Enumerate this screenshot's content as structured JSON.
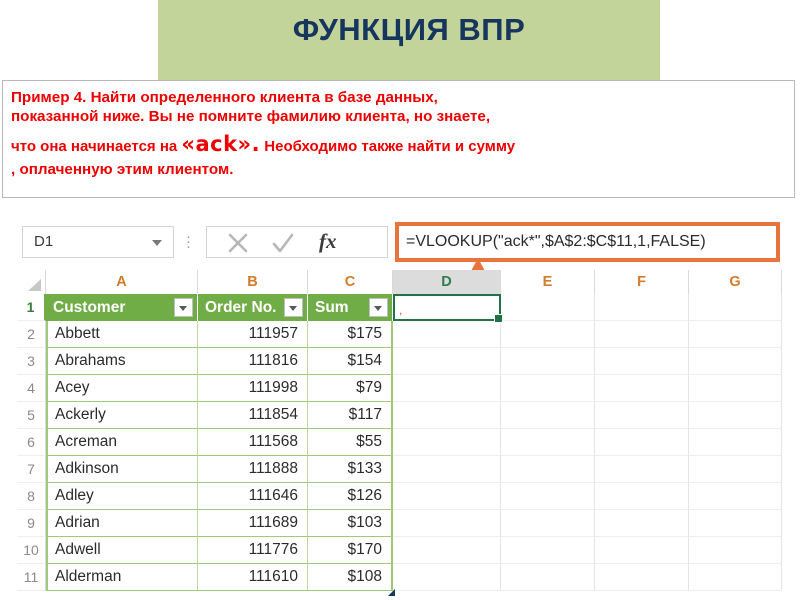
{
  "slide": {
    "title": "ФУНКЦИЯ ВПР",
    "title_bg": "#c3d49a",
    "title_color": "#17365d",
    "description": {
      "color": "#ee0000",
      "line1": "Пример 4. Найти  определенного клиента в базе данных,",
      "line2": "показанной ниже. Вы не помните  фамилию клиента, но знаете,",
      "line3_before": "что она начинается на ",
      "line3_token": "«ack».",
      "line3_after": " Необходимо также найти и сумму",
      "line4": ", оплаченную этим клиентом."
    }
  },
  "excel": {
    "name_box": {
      "value": "D1"
    },
    "formula_bar": {
      "cancel_icon": "cancel-icon",
      "enter_icon": "enter-icon",
      "fx_icon": "fx",
      "formula": "=VLOOKUP(\"ack*\",$A$2:$C$11,1,FALSE)",
      "highlight_color": "#e8743b"
    },
    "annotation": {
      "arrow_icon": "up-arrow-icon",
      "color": "#e8743b"
    },
    "columns": [
      "A",
      "B",
      "C",
      "D",
      "E",
      "F",
      "G"
    ],
    "active_column": "D",
    "selected_cell": "D1",
    "table": {
      "header_bg": "#70ad47",
      "headers": [
        "Customer",
        "Order No.",
        "Sum"
      ],
      "rows": [
        {
          "n": "2",
          "customer": "Abbett",
          "order": "111957",
          "sum": "$175"
        },
        {
          "n": "3",
          "customer": "Abrahams",
          "order": "111816",
          "sum": "$154"
        },
        {
          "n": "4",
          "customer": "Acey",
          "order": "111998",
          "sum": "$79"
        },
        {
          "n": "5",
          "customer": "Ackerly",
          "order": "111854",
          "sum": "$117"
        },
        {
          "n": "6",
          "customer": "Acreman",
          "order": "111568",
          "sum": "$55"
        },
        {
          "n": "7",
          "customer": "Adkinson",
          "order": "111888",
          "sum": "$133"
        },
        {
          "n": "8",
          "customer": "Adley",
          "order": "111646",
          "sum": "$126"
        },
        {
          "n": "9",
          "customer": "Adrian",
          "order": "111689",
          "sum": "$103"
        },
        {
          "n": "10",
          "customer": "Adwell",
          "order": "111776",
          "sum": "$170"
        },
        {
          "n": "11",
          "customer": "Alderman",
          "order": "111610",
          "sum": "$108"
        }
      ],
      "header_row_number": "1"
    }
  }
}
